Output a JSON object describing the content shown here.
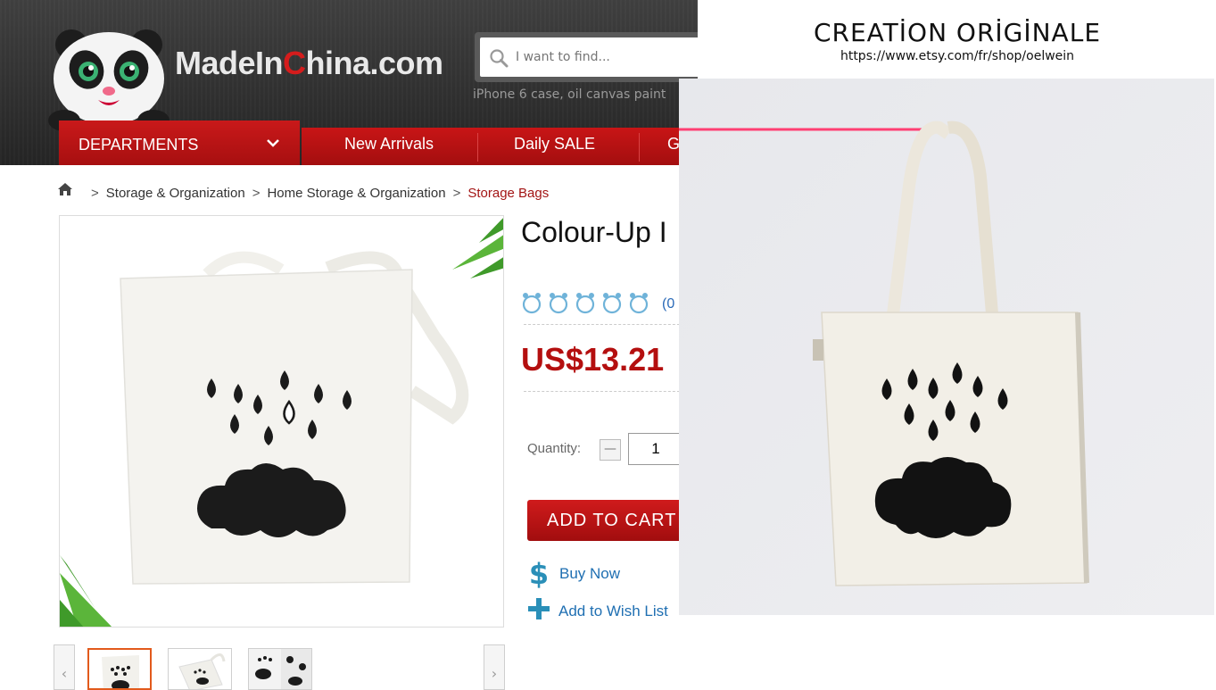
{
  "header": {
    "brand_main": "MadeIn",
    "brand_accent": "C",
    "brand_tail": "hina.com",
    "search_placeholder": "I want to find...",
    "hot_searches": "iPhone 6 case,  oil canvas paint"
  },
  "nav": {
    "departments": "DEPARTMENTS",
    "items": [
      "New Arrivals",
      "Daily SALE",
      "G"
    ]
  },
  "breadcrumb": {
    "items": [
      "Storage & Organization",
      "Home Storage & Organization"
    ],
    "current": "Storage Bags"
  },
  "product": {
    "title": "Colour-Up I",
    "rating_count": "(0",
    "price": "US$13.21",
    "quantity_label": "Quantity:",
    "quantity_value": "1",
    "minus_label": "—",
    "add_to_cart": "ADD TO CART",
    "buy_now": "Buy Now",
    "add_to_wishlist": "Add to Wish List"
  },
  "overlay": {
    "title": "CREATİON ORİGİNALE",
    "url": "https://www.etsy.com/fr/shop/oelwein"
  },
  "colors": {
    "brand_red": "#c81516",
    "price_red": "#b40f0f",
    "link_blue": "#1f6fb2"
  },
  "icons": [
    "panda-mascot",
    "search-icon",
    "chevron-down-icon",
    "home-icon",
    "paw-icon",
    "dollar-icon",
    "plus-icon",
    "arrow-left-icon",
    "arrow-right-icon"
  ]
}
